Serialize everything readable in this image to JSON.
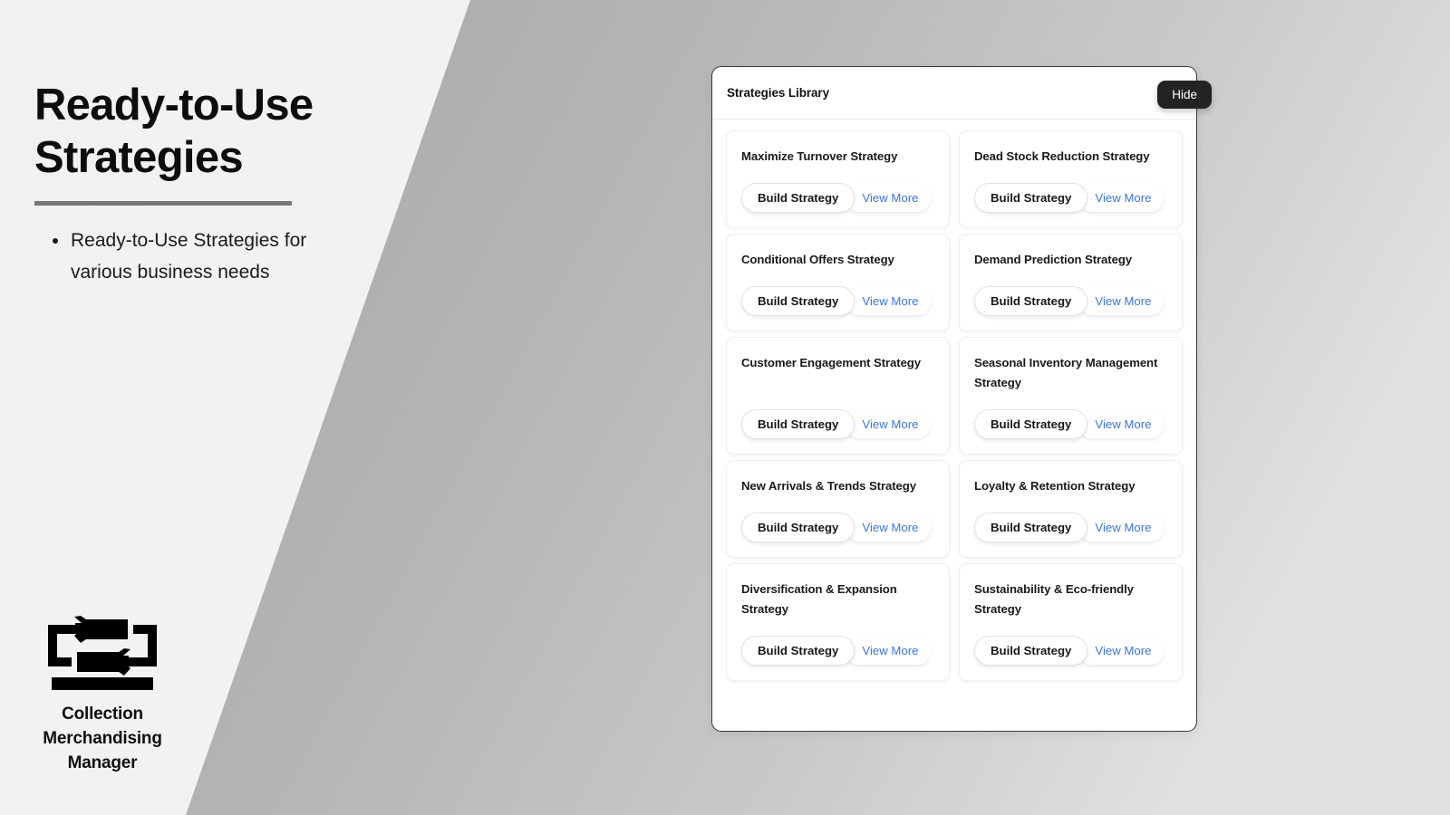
{
  "slide": {
    "title": "Ready-to-Use Strategies",
    "bullets": [
      "Ready-to-Use Strategies for various business needs"
    ],
    "brand_name": "Collection Merchandising Manager",
    "brand_logo_icon": "cyclic-arrows-bars-icon",
    "divider_color": "#787878",
    "background_colors": [
      "#f1f1f1",
      "#fcfcfc"
    ],
    "diagonal_color": "#b2b2b2"
  },
  "panel": {
    "title": "Strategies Library",
    "hide_label": "Hide",
    "hide_button_color": "#232323",
    "accent_link_color": "#3b76e0",
    "build_label": "Build Strategy",
    "view_more_label": "View More",
    "cards": [
      {
        "title": "Maximize Turnover Strategy"
      },
      {
        "title": "Dead Stock Reduction Strategy"
      },
      {
        "title": "Conditional Offers Strategy"
      },
      {
        "title": "Demand Prediction Strategy"
      },
      {
        "title": "Customer Engagement Strategy"
      },
      {
        "title": "Seasonal Inventory Management Strategy"
      },
      {
        "title": "New Arrivals & Trends Strategy"
      },
      {
        "title": "Loyalty & Retention Strategy"
      },
      {
        "title": "Diversification & Expansion Strategy"
      },
      {
        "title": "Sustainability & Eco-friendly Strategy"
      }
    ]
  }
}
